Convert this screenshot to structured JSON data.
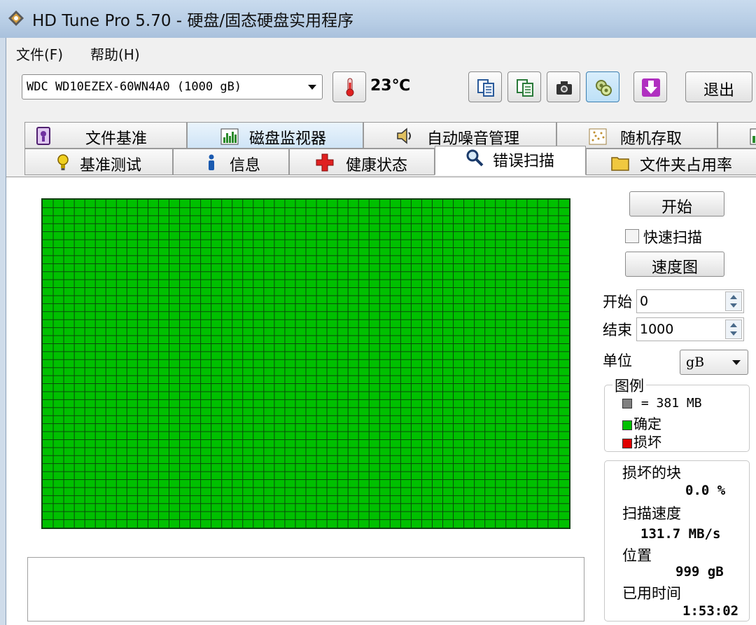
{
  "window": {
    "title": "HD Tune Pro 5.70 - 硬盘/固态硬盘实用程序"
  },
  "menu": {
    "file": "文件(F)",
    "help": "帮助(H)"
  },
  "toolbar": {
    "drive": "WDC WD10EZEX-60WN4A0 (1000 gB)",
    "temperature": "23℃",
    "exit_label": "退出"
  },
  "tabs": {
    "row1": [
      {
        "label": "文件基准"
      },
      {
        "label": "磁盘监视器"
      },
      {
        "label": "自动噪音管理"
      },
      {
        "label": "随机存取"
      }
    ],
    "row2": [
      {
        "label": "基准测试"
      },
      {
        "label": "信息"
      },
      {
        "label": "健康状态"
      },
      {
        "label": "错误扫描"
      },
      {
        "label": "文件夹占用率"
      }
    ],
    "active": "错误扫描"
  },
  "scan_panel": {
    "start_button": "开始",
    "quick_scan_label": "快速扫描",
    "quick_scan_checked": false,
    "speed_map_button": "速度图",
    "start_label": "开始",
    "start_value": "0",
    "end_label": "结束",
    "end_value": "1000",
    "unit_label": "单位",
    "unit_value": "gB",
    "grid_status": "all_ok",
    "block_colors": {
      "ok": "#00c000",
      "bad": "#e00000",
      "unscanned": "#808080"
    }
  },
  "legend": {
    "title": "图例",
    "block_size": "= 381 MB",
    "ok_label": "确定",
    "bad_label": "损坏"
  },
  "stats": {
    "damaged_label": "损坏的块",
    "damaged_value": "0.0 %",
    "speed_label": "扫描速度",
    "speed_value": "131.7 MB/s",
    "position_label": "位置",
    "position_value": "999 gB",
    "elapsed_label": "已用时间",
    "elapsed_value": "1:53:02"
  }
}
